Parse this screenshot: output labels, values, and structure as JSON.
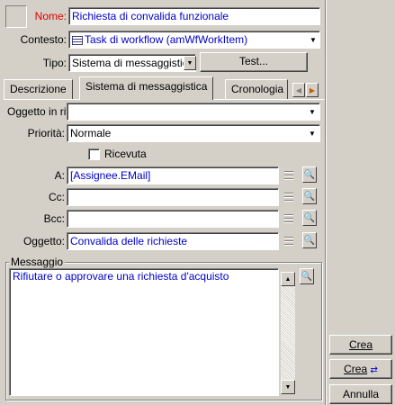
{
  "header": {
    "name_label": "Nome:",
    "name_value": "Richiesta di convalida funzionale",
    "context_label": "Contesto:",
    "context_value": "Task di workflow (amWfWorkItem)",
    "type_label": "Tipo:",
    "type_value": "Sistema di messaggistic",
    "test_button": "Test..."
  },
  "tabs": [
    {
      "label": "Descrizione"
    },
    {
      "label": "Sistema di messaggistica"
    },
    {
      "label": "Cronologia"
    }
  ],
  "form": {
    "oggetto_rif_label": "Oggetto in rif.:",
    "oggetto_rif_value": "",
    "priorita_label": "Priorità:",
    "priorita_value": "Normale",
    "ricevuta_label": "Ricevuta",
    "a_label": "A:",
    "a_value": "[Assignee.EMail]",
    "cc_label": "Cc:",
    "cc_value": "",
    "bcc_label": "Bcc:",
    "bcc_value": "",
    "oggetto_label": "Oggetto:",
    "oggetto_value": "Convalida delle richieste",
    "messaggio_label": "Messaggio",
    "messaggio_value": "Rifiutare o approvare una richiesta d'acquisto"
  },
  "actions": {
    "crea": "Crea",
    "crea_wizard": "Crea",
    "annulla": "Annulla"
  },
  "colors": {
    "name_label": "#e00000",
    "value_text": "#0000c8"
  }
}
